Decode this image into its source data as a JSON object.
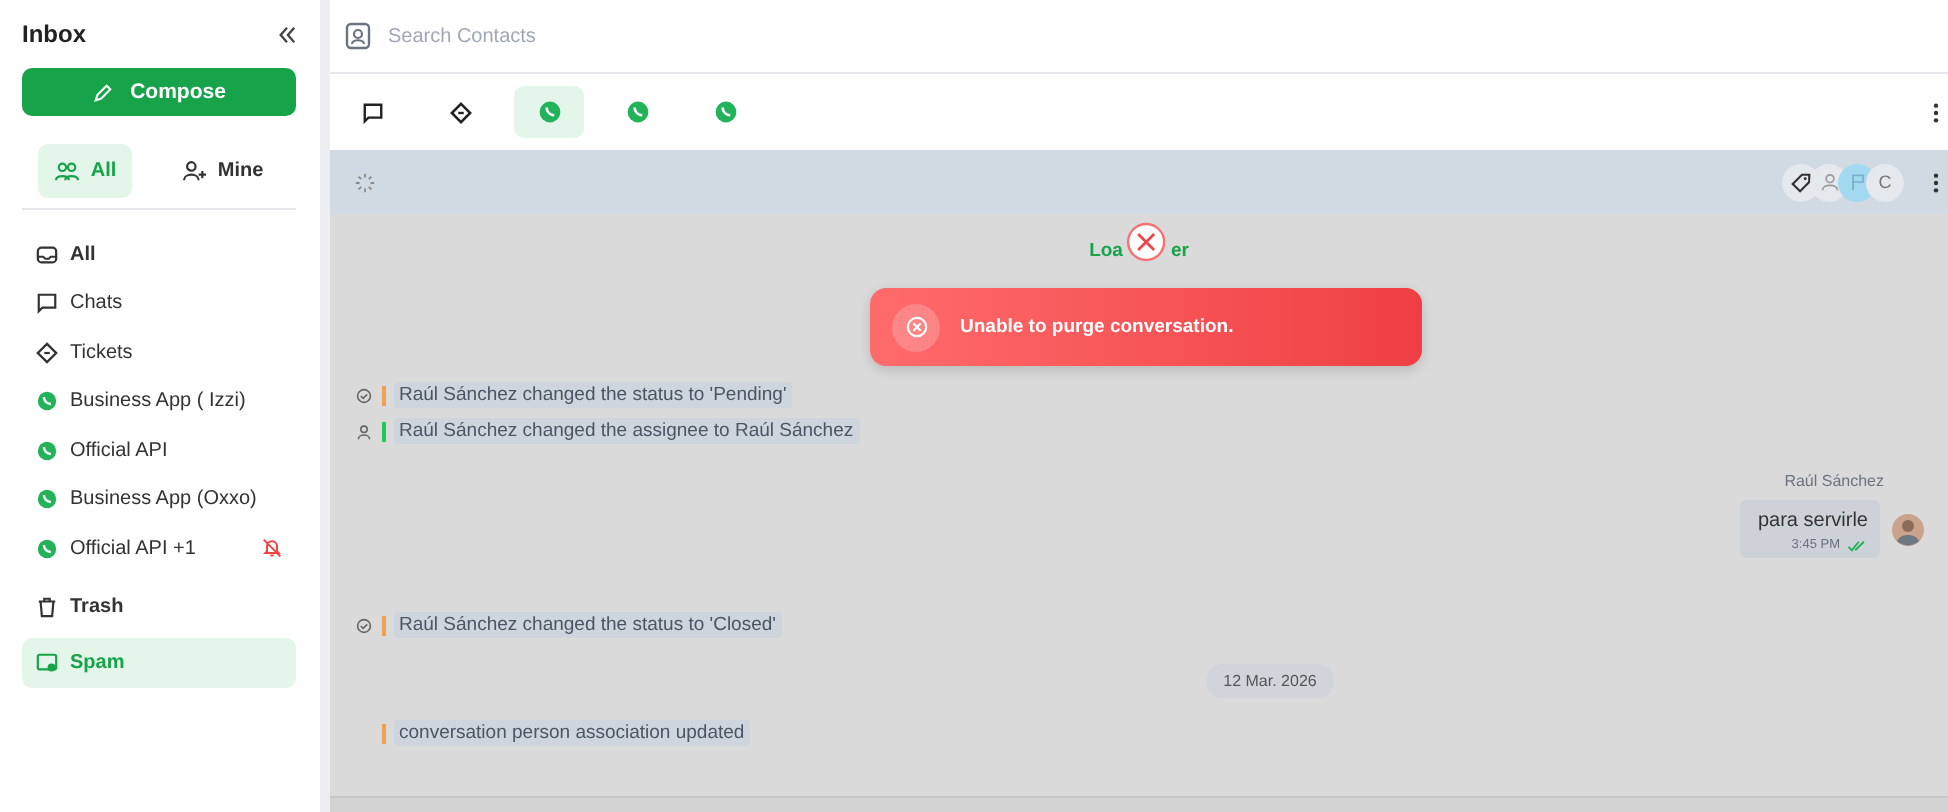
{
  "sidebar": {
    "title": "Inbox",
    "compose": "Compose",
    "filters": [
      {
        "label": "All",
        "kind": "all",
        "selected": true
      },
      {
        "label": "Mine",
        "kind": "mine",
        "selected": false
      }
    ],
    "items": [
      {
        "label": "All",
        "kind": "inbox",
        "selected": false,
        "muted": false
      },
      {
        "label": "Chats",
        "kind": "chat",
        "selected": false,
        "muted": false
      },
      {
        "label": "Tickets",
        "kind": "ticket",
        "selected": false,
        "muted": false
      },
      {
        "label": "Business App ( Izzi)",
        "kind": "whatsapp",
        "selected": false,
        "muted": false
      },
      {
        "label": "Official API",
        "kind": "whatsapp",
        "selected": false,
        "muted": false
      },
      {
        "label": "Business App (Oxxo)",
        "kind": "whatsapp",
        "selected": false,
        "muted": false
      },
      {
        "label": "Official API +1",
        "kind": "whatsapp",
        "selected": false,
        "muted": true
      },
      {
        "label": "Trash",
        "kind": "trash",
        "selected": false,
        "muted": false
      },
      {
        "label": "Spam",
        "kind": "spam",
        "selected": true,
        "muted": false
      }
    ]
  },
  "search": {
    "placeholder": "Search Contacts"
  },
  "channel_tabs": [
    {
      "kind": "chat",
      "selected": false
    },
    {
      "kind": "ticket",
      "selected": false
    },
    {
      "kind": "whatsapp",
      "selected": true
    },
    {
      "kind": "whatsapp",
      "selected": false
    },
    {
      "kind": "whatsapp",
      "selected": false
    }
  ],
  "header": {
    "avatar_letter": "C"
  },
  "loader": {
    "before": "Loa",
    "after": "er"
  },
  "toast": {
    "message": "Unable to purge conversation."
  },
  "timeline": [
    {
      "kind": "status_event",
      "color": "#f0a050",
      "text": "Raúl Sánchez changed the status to 'Pending'"
    },
    {
      "kind": "assignee_event",
      "color": "#22c55e",
      "text": "Raúl Sánchez changed the assignee to Raúl Sánchez"
    },
    {
      "kind": "message",
      "sender": "Raúl Sánchez",
      "text": "para servirle",
      "time": "3:45 PM"
    },
    {
      "kind": "status_event",
      "color": "#f0a050",
      "text": "Raúl Sánchez changed the status to 'Closed'"
    },
    {
      "kind": "date",
      "text": "12 Mar. 2026"
    },
    {
      "kind": "event",
      "color": "#f0a050",
      "text": "conversation person association updated"
    }
  ]
}
